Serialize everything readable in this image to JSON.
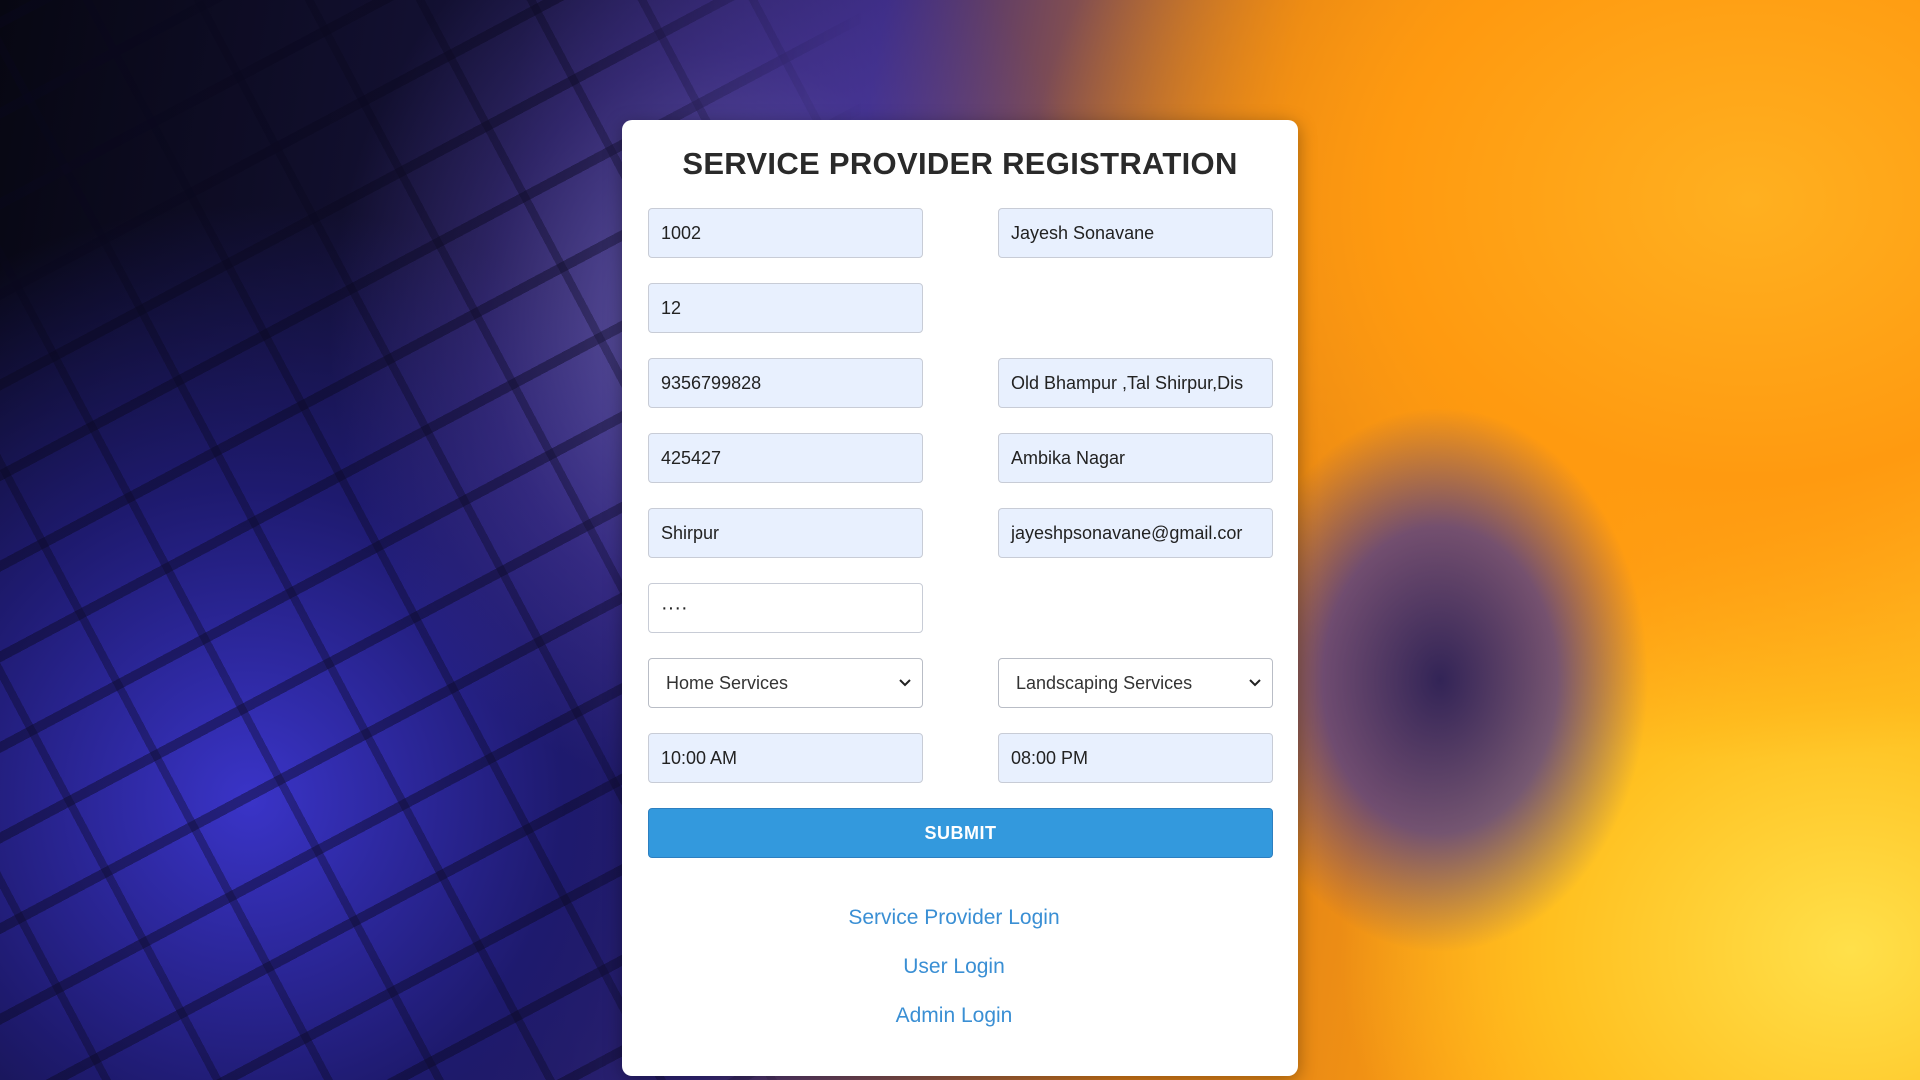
{
  "form": {
    "title": "SERVICE PROVIDER REGISTRATION",
    "fields": {
      "provider_id": "1002",
      "name": "Jayesh Sonavane",
      "age": "12",
      "mobile": "9356799828",
      "address": "Old Bhampur ,Tal Shirpur,Dis",
      "pincode": "425427",
      "area": "Ambika Nagar",
      "city": "Shirpur",
      "email": "jayeshpsonavane@gmail.cor",
      "password": "····",
      "category": "Home Services",
      "service": "Landscaping Services",
      "open_time": "10:00 AM",
      "close_time": "08:00 PM"
    },
    "submit_label": "SUBMIT"
  },
  "links": {
    "provider_login": "Service Provider Login",
    "user_login": "User Login",
    "admin_login": "Admin Login"
  },
  "colors": {
    "accent": "#3399dd",
    "link": "#3a8fd4",
    "autofill_bg": "#e8f0fe"
  },
  "icons": {
    "select_arrow": "chevron-down-icon"
  }
}
